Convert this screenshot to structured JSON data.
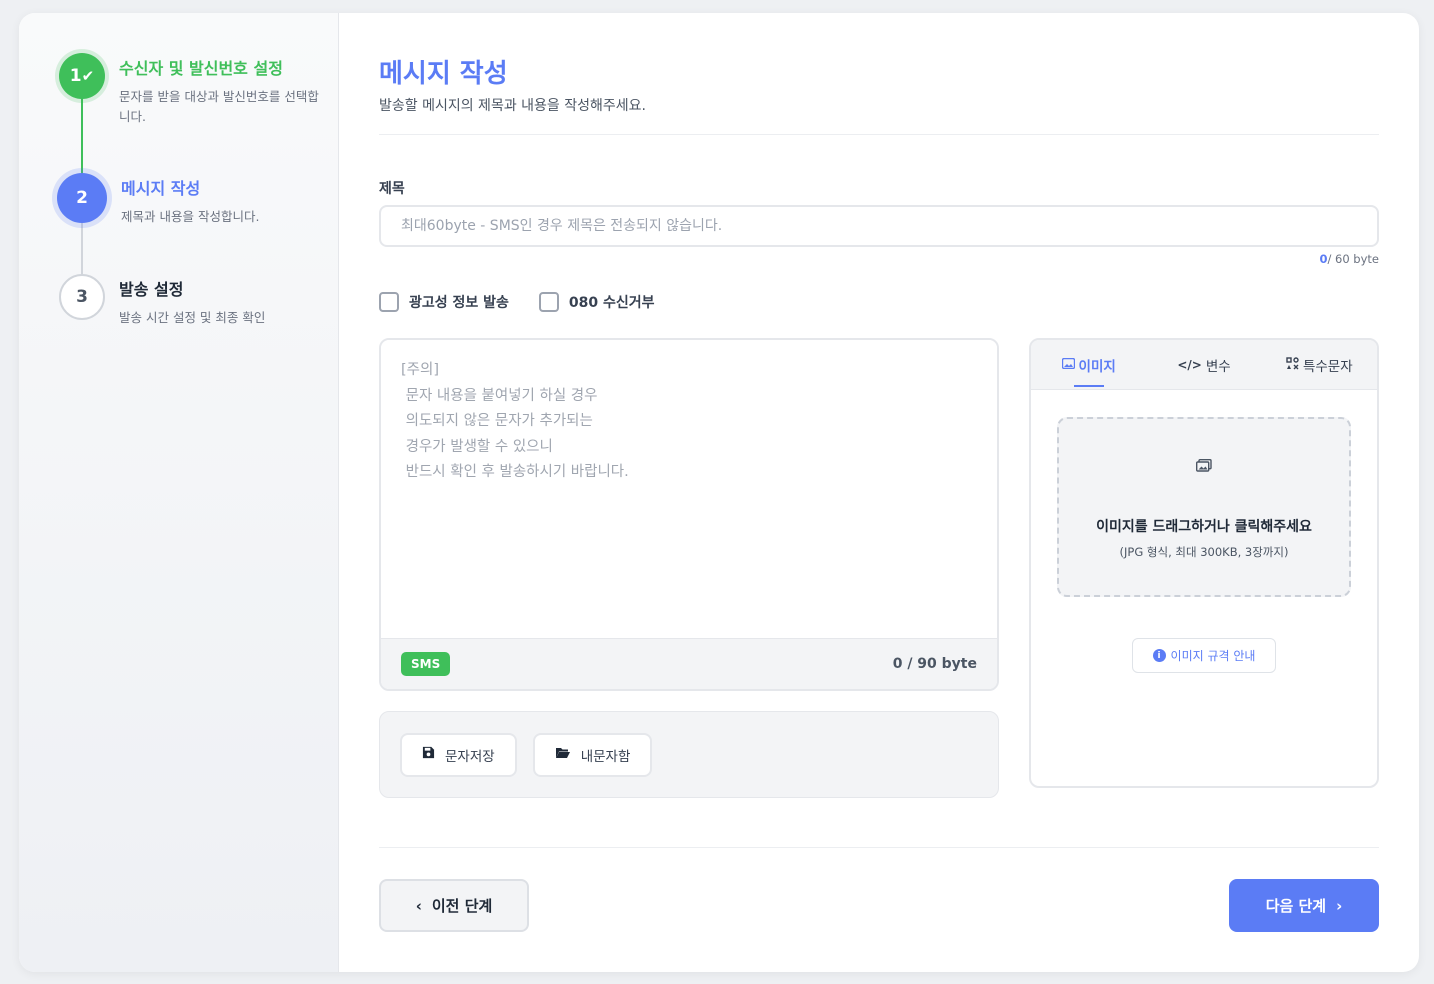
{
  "steps": [
    {
      "number": "1",
      "title": "수신자 및 발신번호 설정",
      "description": "문자를 받을 대상과 발신번호를 선택합니다.",
      "status": "done",
      "icon": "check-icon"
    },
    {
      "number": "2",
      "title": "메시지 작성",
      "description": "제목과 내용을 작성합니다.",
      "status": "active"
    },
    {
      "number": "3",
      "title": "발송 설정",
      "description": "발송 시간 설정 및 최종 확인",
      "status": "pending"
    }
  ],
  "header": {
    "title": "메시지 작성",
    "subtitle": "발송할 메시지의 제목과 내용을 작성해주세요."
  },
  "title_field": {
    "label": "제목",
    "value": "",
    "placeholder": "최대60byte - SMS인 경우 제목은 전송되지 않습니다.",
    "byte_count": "0",
    "byte_limit": "/ 60 byte"
  },
  "options": {
    "ad_label": "광고성 정보 발송",
    "ad_checked": false,
    "optout_label": "080 수신거부",
    "optout_checked": false
  },
  "message": {
    "value": "",
    "placeholder": "[주의]\n 문자 내용을 붙여넣기 하실 경우\n 의도되지 않은 문자가 추가되는\n 경우가 발생할 수 있으니\n 반드시 확인 후 발송하시기 바랍니다.",
    "type_badge": "SMS",
    "bytes": "0 / 90 byte"
  },
  "actions": {
    "save_label": "문자저장",
    "save_icon": "save-icon",
    "my_messages_label": "내문자함",
    "my_messages_icon": "folder-open-icon"
  },
  "side_panel": {
    "tabs": [
      {
        "label": "이미지",
        "icon": "image-icon",
        "active": true
      },
      {
        "label": "변수",
        "icon": "code-icon",
        "active": false
      },
      {
        "label": "특수문자",
        "icon": "special-chars-icon",
        "active": false
      }
    ],
    "dropzone_text": "이미지를 드래그하거나 클릭해주세요",
    "dropzone_sub": "(JPG 형식, 최대 300KB, 3장까지)",
    "spec_button": "이미지 규격 안내"
  },
  "footer": {
    "prev_label": "이전 단계",
    "next_label": "다음 단계"
  },
  "colors": {
    "accent": "#5b7cf5",
    "success": "#3fbf5a"
  }
}
